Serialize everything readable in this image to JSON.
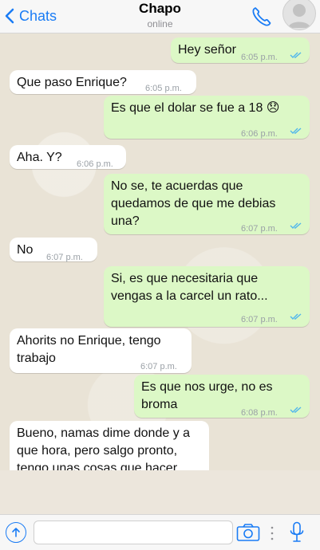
{
  "header": {
    "back_label": "Chats",
    "contact_name": "Chapo",
    "status": "online"
  },
  "messages": [
    {
      "text": "Hey señor",
      "time": "6:05 p.m."
    },
    {
      "text": "Que paso Enrique?",
      "time": "6:05 p.m."
    },
    {
      "text": "Es que el dolar se fue a 18 😞",
      "time": "6:06 p.m."
    },
    {
      "text": "Aha. Y?",
      "time": "6:06 p.m."
    },
    {
      "text": "No se, te acuerdas que\nquedamos de que me debias\nuna?",
      "time": "6:07 p.m."
    },
    {
      "text": "No",
      "time": "6:07 p.m."
    },
    {
      "text": "Si, es que necesitaria que\nvengas a la carcel un rato...",
      "time": "6:07 p.m."
    },
    {
      "text": "Ahorits no Enrique, tengo\ntrabajo",
      "time": "6:07 p.m."
    },
    {
      "text": "Es que nos urge, no es\nbroma",
      "time": "6:08 p.m."
    },
    {
      "text": "Bueno, namas dime donde y a\nque hora, pero salgo pronto,\ntengo unas cosas que hacer",
      "time": ""
    }
  ],
  "colors": {
    "accent": "#1a7cf5",
    "outgoing_bubble": "#dcf8c6",
    "incoming_bubble": "#ffffff",
    "read_ticks": "#4fb6ec"
  },
  "icons": [
    "chevron-left-icon",
    "phone-icon",
    "avatar-icon",
    "double-check-icon",
    "share-icon",
    "camera-icon",
    "mic-icon"
  ]
}
